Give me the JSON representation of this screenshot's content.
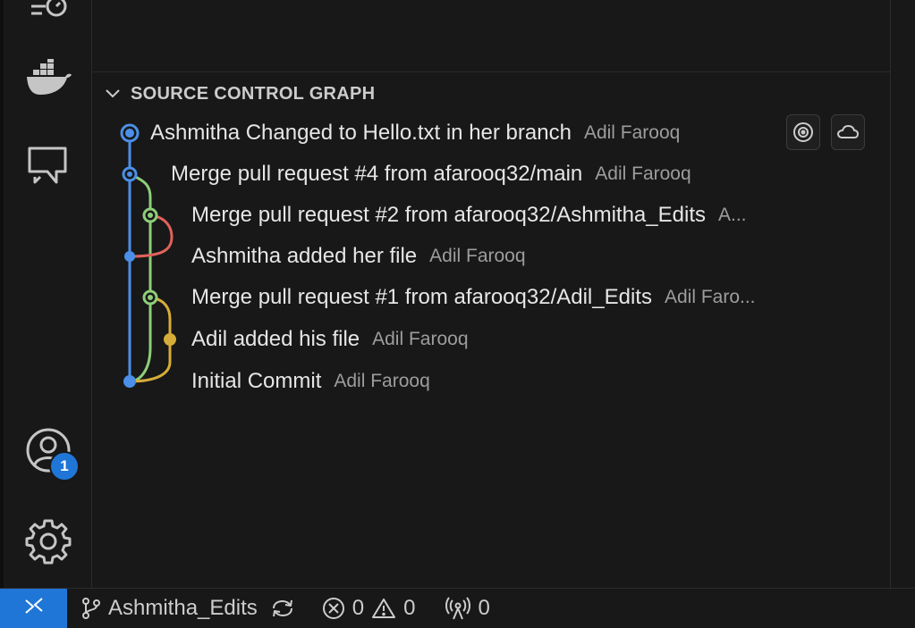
{
  "section": {
    "title": "SOURCE CONTROL GRAPH"
  },
  "commits": [
    {
      "message": "Ashmitha Changed to Hello.txt in her branch",
      "author": "Adil Farooq"
    },
    {
      "message": "Merge pull request #4 from afarooq32/main",
      "author": "Adil Farooq"
    },
    {
      "message": "Merge pull request #2 from afarooq32/Ashmitha_Edits",
      "author": "A..."
    },
    {
      "message": "Ashmitha added her file",
      "author": "Adil Farooq"
    },
    {
      "message": "Merge pull request #1 from afarooq32/Adil_Edits",
      "author": "Adil Faro..."
    },
    {
      "message": "Adil added his file",
      "author": "Adil Farooq"
    },
    {
      "message": "Initial Commit",
      "author": "Adil Farooq"
    }
  ],
  "activity": {
    "accounts_badge": "1"
  },
  "status": {
    "branch": "Ashmitha_Edits",
    "errors": "0",
    "warnings": "0",
    "ports": "0"
  },
  "colors": {
    "accent": "#1f76d6",
    "lane_blue": "#4b8fe8",
    "lane_green": "#8fce7a",
    "lane_red": "#e0625c",
    "lane_yellow": "#d7ad3a"
  },
  "icons": {
    "activity": [
      "timeline-icon",
      "docker-icon",
      "chat-icon",
      "accounts-icon",
      "gear-icon"
    ],
    "row_actions": [
      "target-icon",
      "cloud-icon"
    ],
    "status": [
      "remote-icon",
      "branch-icon",
      "sync-icon",
      "error-icon",
      "warning-icon",
      "broadcast-icon"
    ]
  }
}
